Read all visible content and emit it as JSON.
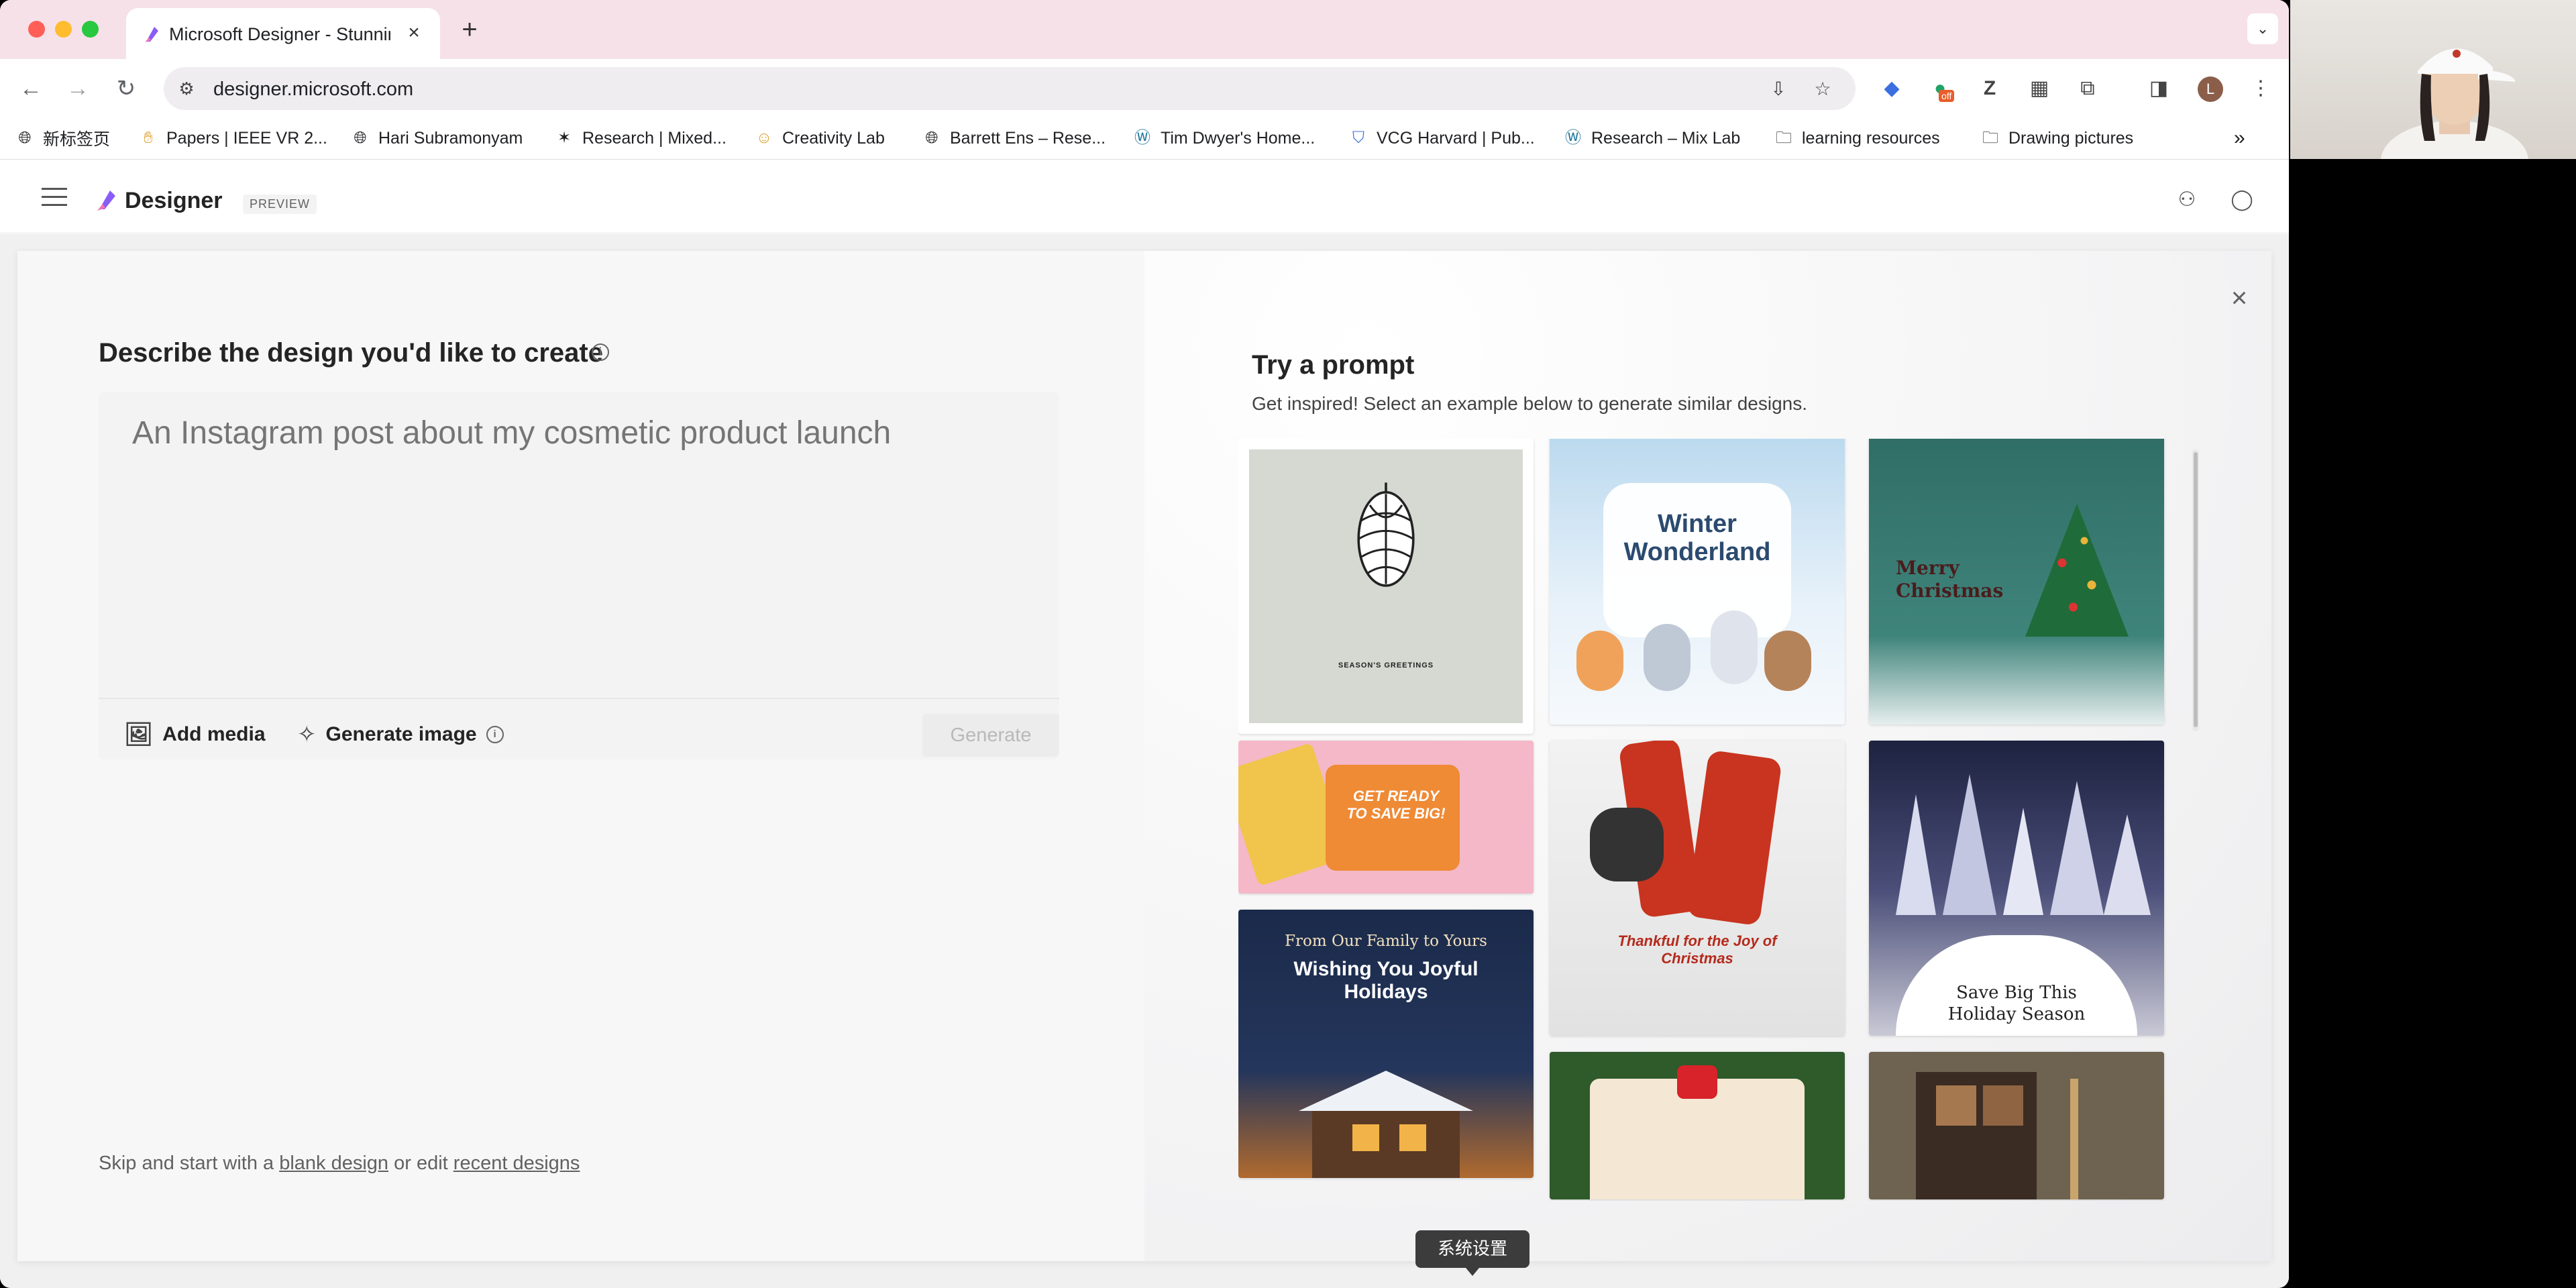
{
  "browser": {
    "tab_title": "Microsoft Designer - Stunning",
    "url": "designer.microsoft.com",
    "extension_badge": "off",
    "profile_initial": "L"
  },
  "bookmarks": [
    {
      "label": "新标签页",
      "icon": "globe-icon"
    },
    {
      "label": "Papers | IEEE VR 2...",
      "icon": "hand-icon"
    },
    {
      "label": "Hari Subramonyam",
      "icon": "globe-icon"
    },
    {
      "label": "Research | Mixed...",
      "icon": "star-icon"
    },
    {
      "label": "Creativity Lab",
      "icon": "face-icon"
    },
    {
      "label": "Barrett Ens – Rese...",
      "icon": "globe-icon"
    },
    {
      "label": "Tim Dwyer's Home...",
      "icon": "wordpress-icon"
    },
    {
      "label": "VCG Harvard | Pub...",
      "icon": "shield-icon"
    },
    {
      "label": "Research – Mix Lab",
      "icon": "wordpress-icon"
    },
    {
      "label": "learning resources",
      "icon": "folder-icon"
    },
    {
      "label": "Drawing pictures",
      "icon": "folder-icon"
    }
  ],
  "app": {
    "brand": "Designer",
    "badge": "PREVIEW"
  },
  "left": {
    "title": "Describe the design you'd like to create",
    "placeholder": "An Instagram post about my cosmetic product launch",
    "add_media": "Add media",
    "generate_image": "Generate image",
    "generate_button": "Generate",
    "skip_prefix": "Skip and start with a",
    "blank_design": "blank design",
    "skip_middle": "or edit",
    "recent_designs": "recent designs"
  },
  "right": {
    "title": "Try a prompt",
    "subtitle": "Get inspired! Select an example below to generate similar designs.",
    "tiles": [
      {
        "text": "SEASON'S GREETINGS"
      },
      {
        "text_line1": "Winter",
        "text_line2": "Wonderland"
      },
      {
        "text_line1": "Merry",
        "text_line2": "Christmas"
      },
      {
        "text_line1": "GET READY",
        "text_line2": "TO SAVE BIG!"
      },
      {
        "text_line1": "Thankful for the Joy of",
        "text_line2": "Christmas"
      },
      {
        "text_line1": "Save Big This",
        "text_line2": "Holiday Season"
      },
      {
        "text_line1": "From Our Family to Yours",
        "text_line2": "Wishing You Joyful",
        "text_line3": "Holidays"
      }
    ]
  },
  "tooltip": "系统设置",
  "colors": {
    "tab_strip": "#f6e1e9",
    "accent_purple": "#8a5cf6"
  }
}
